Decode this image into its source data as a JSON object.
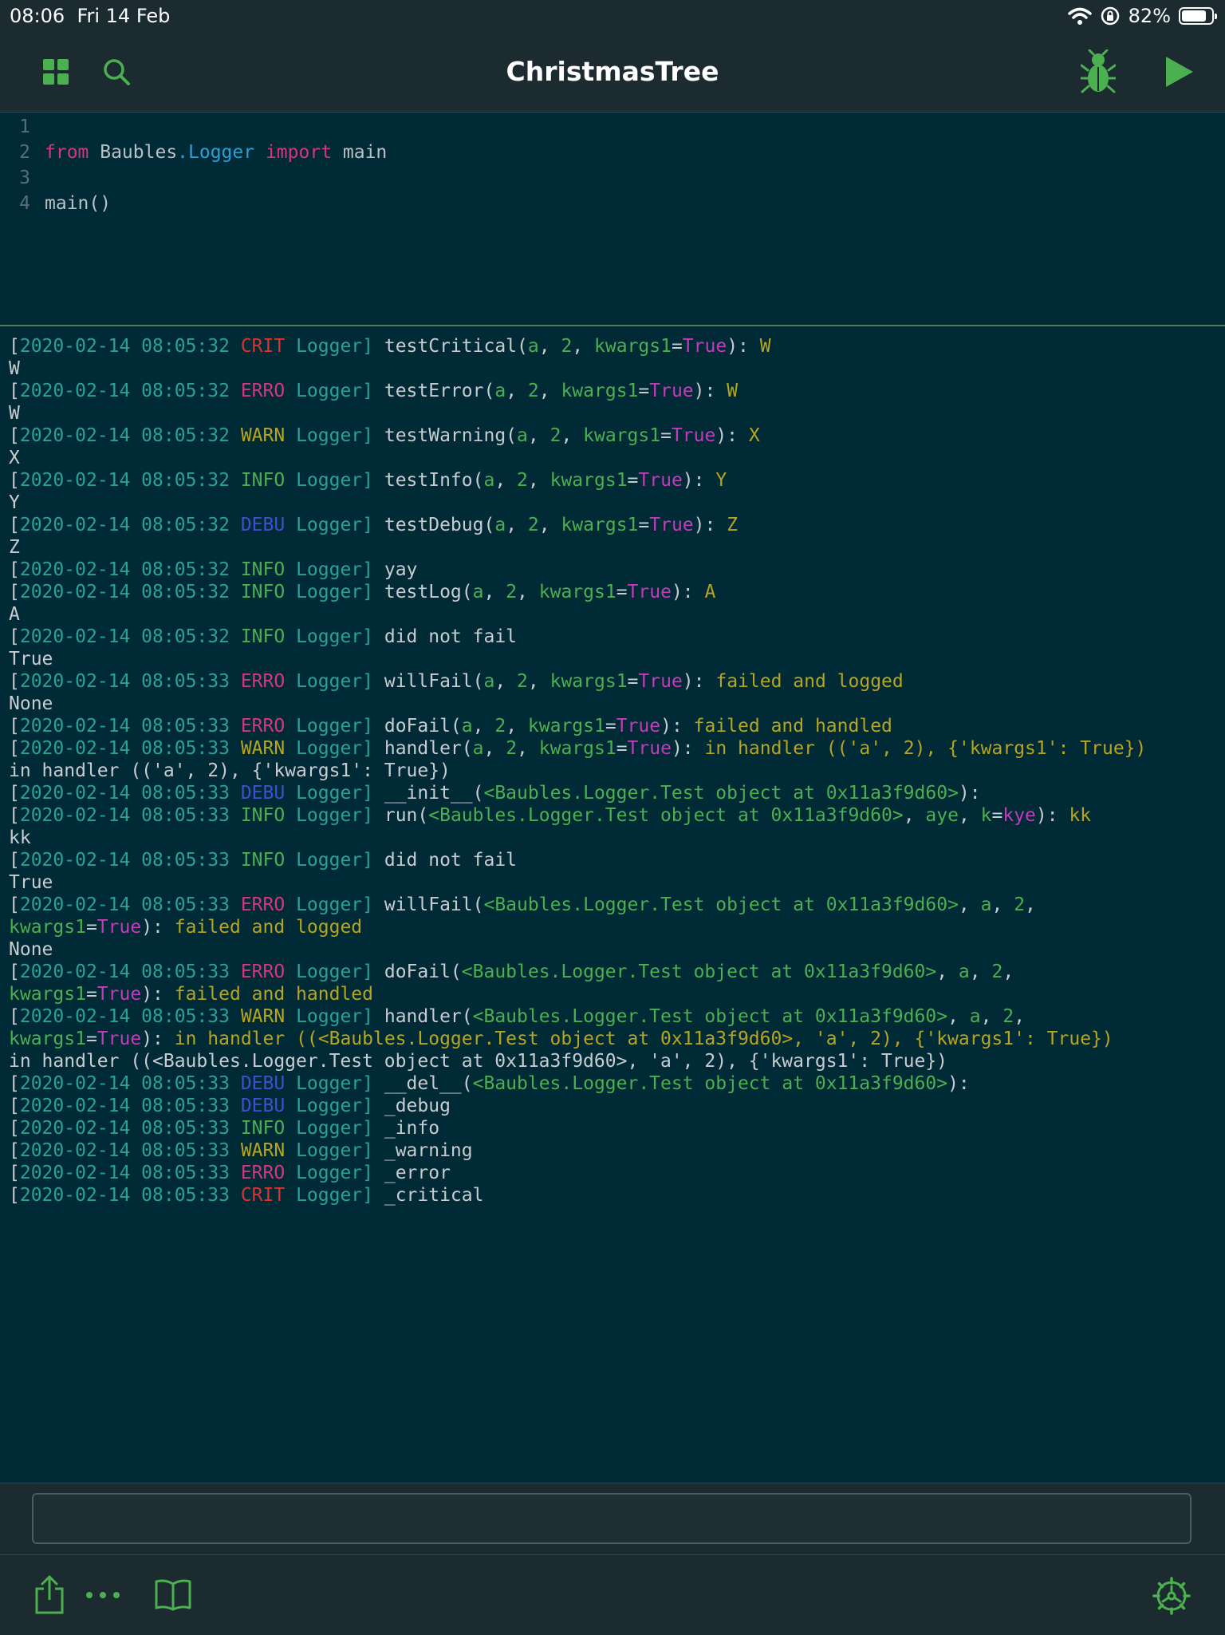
{
  "status_bar": {
    "time": "08:06",
    "date": "Fri 14 Feb",
    "battery": "82%"
  },
  "toolbar": {
    "title": "ChristmasTree"
  },
  "editor": {
    "lines": [
      {
        "num": "1",
        "tokens": []
      },
      {
        "num": "2",
        "tokens": [
          {
            "text": "from",
            "style": "kw"
          },
          {
            "text": " Baubles",
            "style": "plain"
          },
          {
            "text": ".Logger",
            "style": "mod"
          },
          {
            "text": " import",
            "style": "kw"
          },
          {
            "text": " main",
            "style": "plain"
          }
        ]
      },
      {
        "num": "3",
        "tokens": []
      },
      {
        "num": "4",
        "tokens": [
          {
            "text": "main()",
            "style": "plain"
          }
        ]
      }
    ]
  },
  "console": {
    "lines": [
      [
        [
          "[",
          ""
        ],
        [
          "2020-02-14 08:05:32",
          "ts"
        ],
        [
          " ",
          ""
        ],
        [
          "CRIT",
          "lvl-CRIT"
        ],
        [
          " Logger]",
          "lg"
        ],
        [
          " testCritical(",
          ""
        ],
        [
          "a",
          "g"
        ],
        [
          ", ",
          ""
        ],
        [
          "2",
          "g"
        ],
        [
          ", ",
          ""
        ],
        [
          "kwargs1",
          "g"
        ],
        [
          "=",
          ""
        ],
        [
          "True",
          "m"
        ],
        [
          "): ",
          ""
        ],
        [
          "W",
          "y"
        ]
      ],
      [
        [
          "W",
          ""
        ]
      ],
      [
        [
          "[",
          ""
        ],
        [
          "2020-02-14 08:05:32",
          "ts"
        ],
        [
          " ",
          ""
        ],
        [
          "ERRO",
          "lvl-ERRO"
        ],
        [
          " Logger]",
          "lg"
        ],
        [
          " testError(",
          ""
        ],
        [
          "a",
          "g"
        ],
        [
          ", ",
          ""
        ],
        [
          "2",
          "g"
        ],
        [
          ", ",
          ""
        ],
        [
          "kwargs1",
          "g"
        ],
        [
          "=",
          ""
        ],
        [
          "True",
          "m"
        ],
        [
          "): ",
          ""
        ],
        [
          "W",
          "y"
        ]
      ],
      [
        [
          "W",
          ""
        ]
      ],
      [
        [
          "[",
          ""
        ],
        [
          "2020-02-14 08:05:32",
          "ts"
        ],
        [
          " ",
          ""
        ],
        [
          "WARN",
          "lvl-WARN"
        ],
        [
          " Logger]",
          "lg"
        ],
        [
          " testWarning(",
          ""
        ],
        [
          "a",
          "g"
        ],
        [
          ", ",
          ""
        ],
        [
          "2",
          "g"
        ],
        [
          ", ",
          ""
        ],
        [
          "kwargs1",
          "g"
        ],
        [
          "=",
          ""
        ],
        [
          "True",
          "m"
        ],
        [
          "): ",
          ""
        ],
        [
          "X",
          "y"
        ]
      ],
      [
        [
          "X",
          ""
        ]
      ],
      [
        [
          "[",
          ""
        ],
        [
          "2020-02-14 08:05:32",
          "ts"
        ],
        [
          " ",
          ""
        ],
        [
          "INFO",
          "lvl-INFO"
        ],
        [
          " Logger]",
          "lg"
        ],
        [
          " testInfo(",
          ""
        ],
        [
          "a",
          "g"
        ],
        [
          ", ",
          ""
        ],
        [
          "2",
          "g"
        ],
        [
          ", ",
          ""
        ],
        [
          "kwargs1",
          "g"
        ],
        [
          "=",
          ""
        ],
        [
          "True",
          "m"
        ],
        [
          "): ",
          ""
        ],
        [
          "Y",
          "y"
        ]
      ],
      [
        [
          "Y",
          ""
        ]
      ],
      [
        [
          "[",
          ""
        ],
        [
          "2020-02-14 08:05:32",
          "ts"
        ],
        [
          " ",
          ""
        ],
        [
          "DEBU",
          "lvl-DEBU"
        ],
        [
          " Logger]",
          "lg"
        ],
        [
          " testDebug(",
          ""
        ],
        [
          "a",
          "g"
        ],
        [
          ", ",
          ""
        ],
        [
          "2",
          "g"
        ],
        [
          ", ",
          ""
        ],
        [
          "kwargs1",
          "g"
        ],
        [
          "=",
          ""
        ],
        [
          "True",
          "m"
        ],
        [
          "): ",
          ""
        ],
        [
          "Z",
          "y"
        ]
      ],
      [
        [
          "Z",
          ""
        ]
      ],
      [
        [
          "[",
          ""
        ],
        [
          "2020-02-14 08:05:32",
          "ts"
        ],
        [
          " ",
          ""
        ],
        [
          "INFO",
          "lvl-INFO"
        ],
        [
          " Logger]",
          "lg"
        ],
        [
          " yay",
          ""
        ]
      ],
      [
        [
          "[",
          ""
        ],
        [
          "2020-02-14 08:05:32",
          "ts"
        ],
        [
          " ",
          ""
        ],
        [
          "INFO",
          "lvl-INFO"
        ],
        [
          " Logger]",
          "lg"
        ],
        [
          " testLog(",
          ""
        ],
        [
          "a",
          "g"
        ],
        [
          ", ",
          ""
        ],
        [
          "2",
          "g"
        ],
        [
          ", ",
          ""
        ],
        [
          "kwargs1",
          "g"
        ],
        [
          "=",
          ""
        ],
        [
          "True",
          "m"
        ],
        [
          "): ",
          ""
        ],
        [
          "A",
          "y"
        ]
      ],
      [
        [
          "A",
          ""
        ]
      ],
      [
        [
          "[",
          ""
        ],
        [
          "2020-02-14 08:05:32",
          "ts"
        ],
        [
          " ",
          ""
        ],
        [
          "INFO",
          "lvl-INFO"
        ],
        [
          " Logger]",
          "lg"
        ],
        [
          " did not fail",
          ""
        ]
      ],
      [
        [
          "True",
          ""
        ]
      ],
      [
        [
          "[",
          ""
        ],
        [
          "2020-02-14 08:05:33",
          "ts"
        ],
        [
          " ",
          ""
        ],
        [
          "ERRO",
          "lvl-ERRO"
        ],
        [
          " Logger]",
          "lg"
        ],
        [
          " willFail(",
          ""
        ],
        [
          "a",
          "g"
        ],
        [
          ", ",
          ""
        ],
        [
          "2",
          "g"
        ],
        [
          ", ",
          ""
        ],
        [
          "kwargs1",
          "g"
        ],
        [
          "=",
          ""
        ],
        [
          "True",
          "m"
        ],
        [
          "): ",
          ""
        ],
        [
          "failed and logged",
          "y"
        ]
      ],
      [
        [
          "None",
          ""
        ]
      ],
      [
        [
          "[",
          ""
        ],
        [
          "2020-02-14 08:05:33",
          "ts"
        ],
        [
          " ",
          ""
        ],
        [
          "ERRO",
          "lvl-ERRO"
        ],
        [
          " Logger]",
          "lg"
        ],
        [
          " doFail(",
          ""
        ],
        [
          "a",
          "g"
        ],
        [
          ", ",
          ""
        ],
        [
          "2",
          "g"
        ],
        [
          ", ",
          ""
        ],
        [
          "kwargs1",
          "g"
        ],
        [
          "=",
          ""
        ],
        [
          "True",
          "m"
        ],
        [
          "): ",
          ""
        ],
        [
          "failed and handled",
          "y"
        ]
      ],
      [
        [
          "[",
          ""
        ],
        [
          "2020-02-14 08:05:33",
          "ts"
        ],
        [
          " ",
          ""
        ],
        [
          "WARN",
          "lvl-WARN"
        ],
        [
          " Logger]",
          "lg"
        ],
        [
          " handler(",
          ""
        ],
        [
          "a",
          "g"
        ],
        [
          ", ",
          ""
        ],
        [
          "2",
          "g"
        ],
        [
          ", ",
          ""
        ],
        [
          "kwargs1",
          "g"
        ],
        [
          "=",
          ""
        ],
        [
          "True",
          "m"
        ],
        [
          "): ",
          ""
        ],
        [
          "in handler (('a', 2), {'kwargs1': True})",
          "y"
        ]
      ],
      [
        [
          "in handler (('a', 2), {'kwargs1': True})",
          ""
        ]
      ],
      [
        [
          "[",
          ""
        ],
        [
          "2020-02-14 08:05:33",
          "ts"
        ],
        [
          " ",
          ""
        ],
        [
          "DEBU",
          "lvl-DEBU"
        ],
        [
          " Logger]",
          "lg"
        ],
        [
          " __init__(",
          ""
        ],
        [
          "<Baubles.Logger.Test object at 0x11a3f9d60>",
          "g"
        ],
        [
          "):",
          ""
        ]
      ],
      [
        [
          "[",
          ""
        ],
        [
          "2020-02-14 08:05:33",
          "ts"
        ],
        [
          " ",
          ""
        ],
        [
          "INFO",
          "lvl-INFO"
        ],
        [
          " Logger]",
          "lg"
        ],
        [
          " run(",
          ""
        ],
        [
          "<Baubles.Logger.Test object at 0x11a3f9d60>",
          "g"
        ],
        [
          ", ",
          ""
        ],
        [
          "aye",
          "g"
        ],
        [
          ", ",
          ""
        ],
        [
          "k",
          "g"
        ],
        [
          "=",
          ""
        ],
        [
          "kye",
          "m"
        ],
        [
          "): ",
          ""
        ],
        [
          "kk",
          "y"
        ]
      ],
      [
        [
          "kk",
          ""
        ]
      ],
      [
        [
          "[",
          ""
        ],
        [
          "2020-02-14 08:05:33",
          "ts"
        ],
        [
          " ",
          ""
        ],
        [
          "INFO",
          "lvl-INFO"
        ],
        [
          " Logger]",
          "lg"
        ],
        [
          " did not fail",
          ""
        ]
      ],
      [
        [
          "True",
          ""
        ]
      ],
      [
        [
          "[",
          ""
        ],
        [
          "2020-02-14 08:05:33",
          "ts"
        ],
        [
          " ",
          ""
        ],
        [
          "ERRO",
          "lvl-ERRO"
        ],
        [
          " Logger]",
          "lg"
        ],
        [
          " willFail(",
          ""
        ],
        [
          "<Baubles.Logger.Test object at 0x11a3f9d60>",
          "g"
        ],
        [
          ", ",
          ""
        ],
        [
          "a",
          "g"
        ],
        [
          ", ",
          ""
        ],
        [
          "2",
          "g"
        ],
        [
          ",",
          ""
        ]
      ],
      [
        [
          "kwargs1",
          "g"
        ],
        [
          "=",
          ""
        ],
        [
          "True",
          "m"
        ],
        [
          "): ",
          ""
        ],
        [
          "failed and logged",
          "y"
        ]
      ],
      [
        [
          "None",
          ""
        ]
      ],
      [
        [
          "[",
          ""
        ],
        [
          "2020-02-14 08:05:33",
          "ts"
        ],
        [
          " ",
          ""
        ],
        [
          "ERRO",
          "lvl-ERRO"
        ],
        [
          " Logger]",
          "lg"
        ],
        [
          " doFail(",
          ""
        ],
        [
          "<Baubles.Logger.Test object at 0x11a3f9d60>",
          "g"
        ],
        [
          ", ",
          ""
        ],
        [
          "a",
          "g"
        ],
        [
          ", ",
          ""
        ],
        [
          "2",
          "g"
        ],
        [
          ",",
          ""
        ]
      ],
      [
        [
          "kwargs1",
          "g"
        ],
        [
          "=",
          ""
        ],
        [
          "True",
          "m"
        ],
        [
          "): ",
          ""
        ],
        [
          "failed and handled",
          "y"
        ]
      ],
      [
        [
          "[",
          ""
        ],
        [
          "2020-02-14 08:05:33",
          "ts"
        ],
        [
          " ",
          ""
        ],
        [
          "WARN",
          "lvl-WARN"
        ],
        [
          " Logger]",
          "lg"
        ],
        [
          " handler(",
          ""
        ],
        [
          "<Baubles.Logger.Test object at 0x11a3f9d60>",
          "g"
        ],
        [
          ", ",
          ""
        ],
        [
          "a",
          "g"
        ],
        [
          ", ",
          ""
        ],
        [
          "2",
          "g"
        ],
        [
          ",",
          ""
        ]
      ],
      [
        [
          "kwargs1",
          "g"
        ],
        [
          "=",
          ""
        ],
        [
          "True",
          "m"
        ],
        [
          "): ",
          ""
        ],
        [
          "in handler ((<Baubles.Logger.Test object at 0x11a3f9d60>, 'a', 2), {'kwargs1': True})",
          "y"
        ]
      ],
      [
        [
          "in handler ((<Baubles.Logger.Test object at 0x11a3f9d60>, 'a', 2), {'kwargs1': True})",
          ""
        ]
      ],
      [
        [
          "[",
          ""
        ],
        [
          "2020-02-14 08:05:33",
          "ts"
        ],
        [
          " ",
          ""
        ],
        [
          "DEBU",
          "lvl-DEBU"
        ],
        [
          " Logger]",
          "lg"
        ],
        [
          " __del__(",
          ""
        ],
        [
          "<Baubles.Logger.Test object at 0x11a3f9d60>",
          "g"
        ],
        [
          "):",
          ""
        ]
      ],
      [
        [
          "[",
          ""
        ],
        [
          "2020-02-14 08:05:33",
          "ts"
        ],
        [
          " ",
          ""
        ],
        [
          "DEBU",
          "lvl-DEBU"
        ],
        [
          " Logger]",
          "lg"
        ],
        [
          " _debug",
          ""
        ]
      ],
      [
        [
          "[",
          ""
        ],
        [
          "2020-02-14 08:05:33",
          "ts"
        ],
        [
          " ",
          ""
        ],
        [
          "INFO",
          "lvl-INFO"
        ],
        [
          " Logger]",
          "lg"
        ],
        [
          " _info",
          ""
        ]
      ],
      [
        [
          "[",
          ""
        ],
        [
          "2020-02-14 08:05:33",
          "ts"
        ],
        [
          " ",
          ""
        ],
        [
          "WARN",
          "lvl-WARN"
        ],
        [
          " Logger]",
          "lg"
        ],
        [
          " _warning",
          ""
        ]
      ],
      [
        [
          "[",
          ""
        ],
        [
          "2020-02-14 08:05:33",
          "ts"
        ],
        [
          " ",
          ""
        ],
        [
          "ERRO",
          "lvl-ERRO"
        ],
        [
          " Logger]",
          "lg"
        ],
        [
          " _error",
          ""
        ]
      ],
      [
        [
          "[",
          ""
        ],
        [
          "2020-02-14 08:05:33",
          "ts"
        ],
        [
          " ",
          ""
        ],
        [
          "CRIT",
          "lvl-CRIT"
        ],
        [
          " Logger]",
          "lg"
        ],
        [
          " _critical",
          ""
        ]
      ]
    ]
  },
  "input": {
    "value": "",
    "placeholder": ""
  },
  "colors": {
    "accent": "#4caf50",
    "background": "#002b36",
    "bar": "#1b2b30"
  },
  "icons": {
    "grid": "grid-icon",
    "search": "search-icon",
    "debug": "bug-icon",
    "run": "play-icon",
    "share": "share-icon",
    "more": "more-icon",
    "docs": "book-icon",
    "settings": "gear-icon",
    "wifi": "wifi-icon",
    "lock": "rotation-lock-icon",
    "battery": "battery-icon"
  }
}
